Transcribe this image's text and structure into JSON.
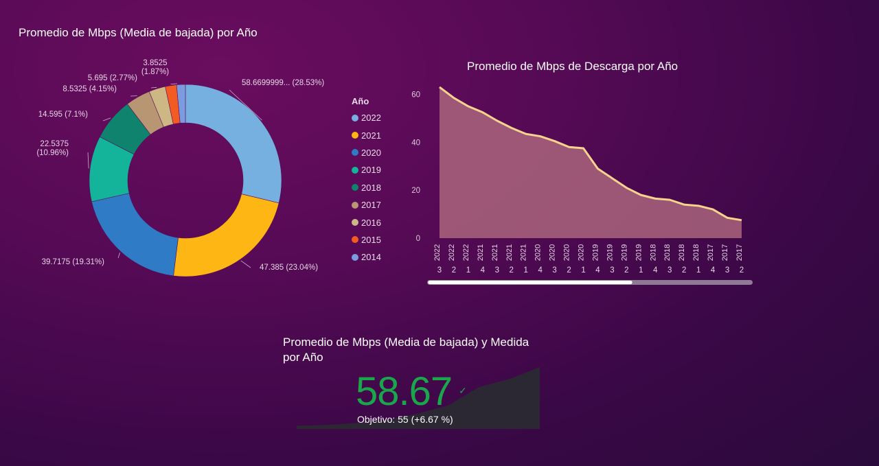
{
  "donut": {
    "title": "Promedio de Mbps (Media de bajada) por Año",
    "legend_title": "Año",
    "labels": [
      "58.6699999... (28.53%)",
      "47.385 (23.04%)",
      "39.7175 (19.31%)",
      "22.5375\n(10.96%)",
      "14.595 (7.1%)",
      "8.5325 (4.15%)",
      "5.695 (2.77%)",
      "3.8525\n(1.87%)",
      ""
    ]
  },
  "area": {
    "title": "Promedio de Mbps de Descarga por Año"
  },
  "kpi": {
    "title": "Promedio de Mbps (Media de bajada) y Medida por Año",
    "value": "58.67",
    "goal": "Objetivo: 55 (+6.67 %)",
    "check_icon": "check-icon"
  },
  "chart_data": [
    {
      "type": "pie",
      "title": "Promedio de Mbps (Media de bajada) por Año",
      "legend_title": "Año",
      "legend_position": "right",
      "categories": [
        "2022",
        "2021",
        "2020",
        "2019",
        "2018",
        "2017",
        "2016",
        "2015",
        "2014"
      ],
      "values": [
        58.67,
        47.385,
        39.7175,
        22.5375,
        14.595,
        8.5325,
        5.695,
        3.8525,
        3.0
      ],
      "percents": [
        28.53,
        23.04,
        19.31,
        10.96,
        7.1,
        4.15,
        2.77,
        1.87,
        1.46
      ],
      "colors": [
        "#76b0e0",
        "#fdb614",
        "#2f7bc5",
        "#13b49a",
        "#0f836d",
        "#b89673",
        "#cdb885",
        "#f35b24",
        "#7c9ae0"
      ]
    },
    {
      "type": "area",
      "title": "Promedio de Mbps de Descarga por Año",
      "x_years": [
        "2022",
        "2022",
        "2022",
        "2021",
        "2021",
        "2021",
        "2021",
        "2020",
        "2020",
        "2020",
        "2020",
        "2019",
        "2019",
        "2019",
        "2019",
        "2018",
        "2018",
        "2018",
        "2018",
        "2017",
        "2017",
        "2017"
      ],
      "x_quarters": [
        "3",
        "2",
        "1",
        "4",
        "3",
        "2",
        "1",
        "4",
        "3",
        "2",
        "1",
        "4",
        "3",
        "2",
        "1",
        "4",
        "3",
        "2",
        "1",
        "4",
        "3",
        "2"
      ],
      "values": [
        63,
        58.5,
        55,
        52.5,
        49,
        46,
        43.5,
        42.5,
        40.5,
        38,
        37.5,
        29,
        25,
        21,
        18,
        16.5,
        16,
        14,
        13.5,
        12,
        8.5,
        7.5
      ],
      "yticks": [
        0,
        20,
        40,
        60
      ],
      "ylim": [
        0,
        65
      ],
      "line_color": "#f7d48c",
      "fill_color": "#b06a80",
      "grid": false
    },
    {
      "type": "area",
      "title": "Promedio de Mbps (Media de bajada) y Medida por Año",
      "values": [
        3.0,
        3.8525,
        5.695,
        8.5325,
        14.595,
        22.5375,
        39.7175,
        47.385,
        58.67
      ],
      "fill_color": "#2a2a34"
    }
  ]
}
